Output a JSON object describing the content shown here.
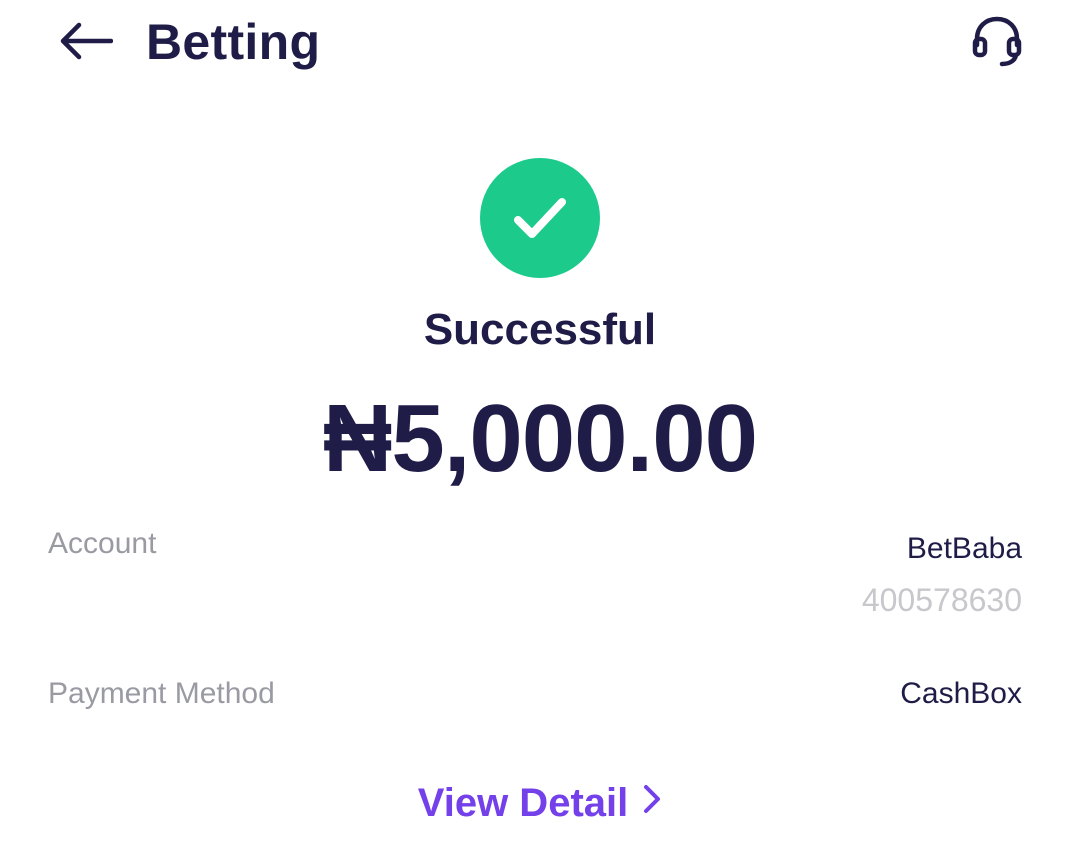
{
  "header": {
    "title": "Betting",
    "back_icon": "arrow-left-icon",
    "support_icon": "headset-icon"
  },
  "status": {
    "icon": "check-icon",
    "text": "Successful",
    "color": "#1ccb8c"
  },
  "amount": "₦5,000.00",
  "details": {
    "account": {
      "label": "Account",
      "name": "BetBaba",
      "number": "400578630"
    },
    "payment_method": {
      "label": "Payment Method",
      "value": "CashBox"
    }
  },
  "view_detail": {
    "label": "View Detail",
    "icon": "chevron-right-icon",
    "color": "#7340ea"
  },
  "colors": {
    "text_primary": "#1f1d47",
    "text_secondary": "#9a9aa3",
    "text_muted": "#c7c7cc"
  }
}
